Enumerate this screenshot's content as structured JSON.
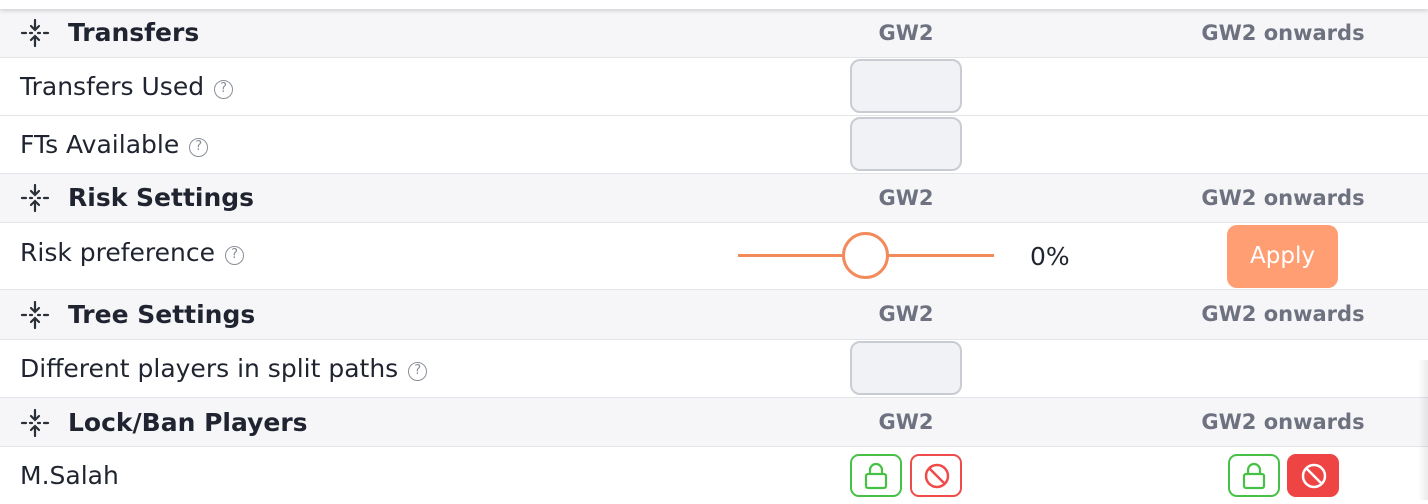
{
  "columns": {
    "gw": "GW2",
    "onwards": "GW2 onwards"
  },
  "transfers": {
    "title": "Transfers",
    "rows": [
      {
        "label": "Transfers Used",
        "value": ""
      },
      {
        "label": "FTs Available",
        "value": ""
      }
    ]
  },
  "risk": {
    "title": "Risk Settings",
    "row_label": "Risk preference",
    "slider_value": 0,
    "slider_display": "0%",
    "apply_label": "Apply"
  },
  "tree": {
    "title": "Tree Settings",
    "row_label": "Different players in split paths",
    "value": ""
  },
  "lockban": {
    "title": "Lock/Ban Players",
    "players": [
      {
        "name": "M.Salah",
        "gw_lock": false,
        "gw_ban": false,
        "onwards_lock": false,
        "onwards_ban": true
      }
    ]
  },
  "help_glyph": "?",
  "colors": {
    "accent": "#f28a5c",
    "apply_bg": "#ff9e73",
    "lock_green": "#46c146",
    "ban_red": "#ef4444",
    "header_bg": "#f6f6f8"
  },
  "icons": {
    "section": "split-arrows-icon",
    "help": "help-circle-icon",
    "lock": "lock-icon",
    "ban": "ban-icon"
  }
}
